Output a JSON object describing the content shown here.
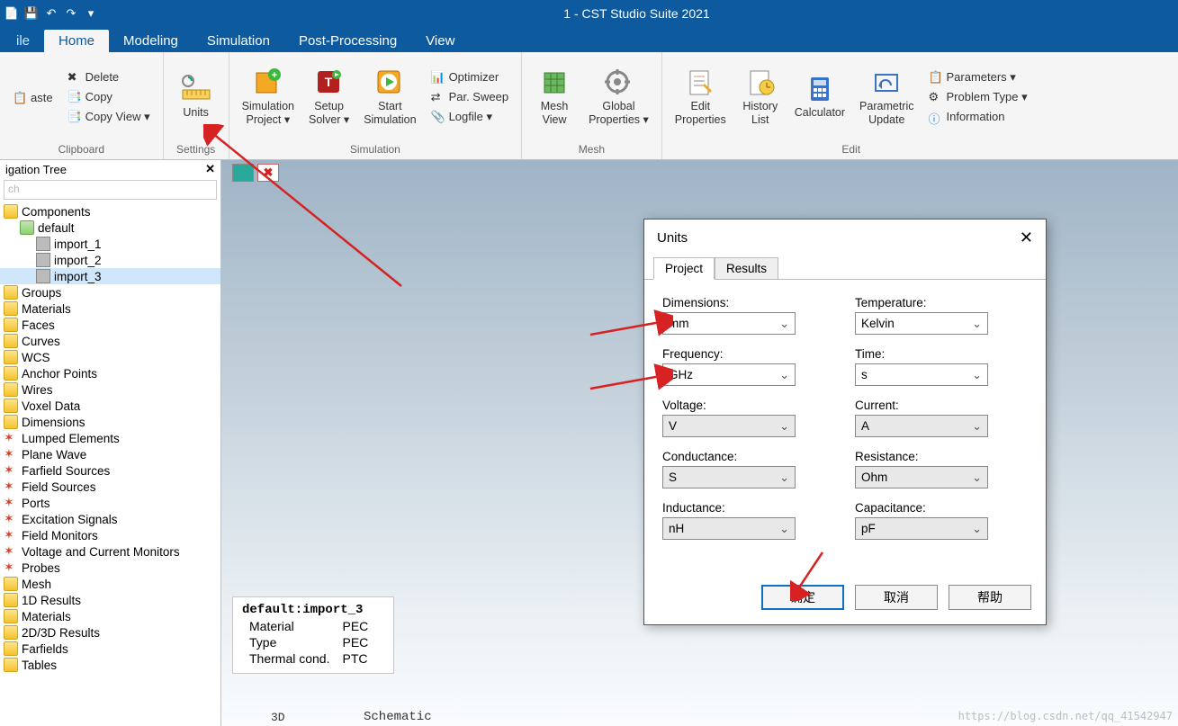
{
  "titlebar": {
    "title": "1 - CST Studio Suite 2021"
  },
  "tabs": {
    "file": "ile",
    "home": "Home",
    "modeling": "Modeling",
    "simulation": "Simulation",
    "post": "Post-Processing",
    "view": "View"
  },
  "ribbon": {
    "clipboard": {
      "label": "Clipboard",
      "paste": "aste",
      "delete": "Delete",
      "copy": "Copy",
      "copyview": "Copy View ▾"
    },
    "settings": {
      "label": "Settings",
      "units": "Units"
    },
    "simulation": {
      "label": "Simulation",
      "simproj": "Simulation\nProject ▾",
      "setup": "Setup\nSolver ▾",
      "start": "Start\nSimulation",
      "optimizer": "Optimizer",
      "parsweep": "Par. Sweep",
      "logfile": "Logfile ▾"
    },
    "mesh": {
      "label": "Mesh",
      "meshview": "Mesh\nView",
      "global": "Global\nProperties ▾"
    },
    "edit": {
      "label": "Edit",
      "editprop": "Edit\nProperties",
      "history": "History\nList",
      "calculator": "Calculator",
      "parametric": "Parametric\nUpdate",
      "parameters": "Parameters ▾",
      "problemtype": "Problem Type ▾",
      "information": "Information"
    }
  },
  "navtree": {
    "title": "igation Tree",
    "search_placeholder": "ch",
    "components": "Components",
    "default": "default",
    "imports": [
      "import_1",
      "import_2",
      "import_3"
    ],
    "items": [
      "Groups",
      "Materials",
      "Faces",
      "Curves",
      "WCS",
      "Anchor Points",
      "Wires",
      "Voxel Data",
      "Dimensions",
      "Lumped Elements",
      "Plane Wave",
      "Farfield Sources",
      "Field Sources",
      "Ports",
      "Excitation Signals",
      "Field Monitors",
      "Voltage and Current Monitors",
      "Probes",
      "Mesh",
      "1D Results",
      "Materials",
      "2D/3D Results",
      "Farfields",
      "Tables"
    ]
  },
  "propbox": {
    "name": "default:import_3",
    "rows": [
      [
        "Material",
        "PEC"
      ],
      [
        "Type",
        "PEC"
      ],
      [
        "Thermal cond.",
        "PTC"
      ]
    ]
  },
  "dialog": {
    "title": "Units",
    "tabs": [
      "Project",
      "Results"
    ],
    "fields": {
      "dimensions": {
        "label": "Dimensions:",
        "value": "mm",
        "active": true
      },
      "temperature": {
        "label": "Temperature:",
        "value": "Kelvin",
        "active": true
      },
      "frequency": {
        "label": "Frequency:",
        "value": "GHz",
        "active": true
      },
      "time": {
        "label": "Time:",
        "value": "s",
        "active": true
      },
      "voltage": {
        "label": "Voltage:",
        "value": "V",
        "active": false
      },
      "current": {
        "label": "Current:",
        "value": "A",
        "active": false
      },
      "conductance": {
        "label": "Conductance:",
        "value": "S",
        "active": false
      },
      "resistance": {
        "label": "Resistance:",
        "value": "Ohm",
        "active": false
      },
      "inductance": {
        "label": "Inductance:",
        "value": "nH",
        "active": false
      },
      "capacitance": {
        "label": "Capacitance:",
        "value": "pF",
        "active": false
      }
    },
    "buttons": {
      "ok": "确定",
      "cancel": "取消",
      "help": "帮助"
    }
  },
  "footer": {
    "schematic": "Schematic",
    "three_d": "3D"
  },
  "watermark": "https://blog.csdn.net/qq_41542947"
}
